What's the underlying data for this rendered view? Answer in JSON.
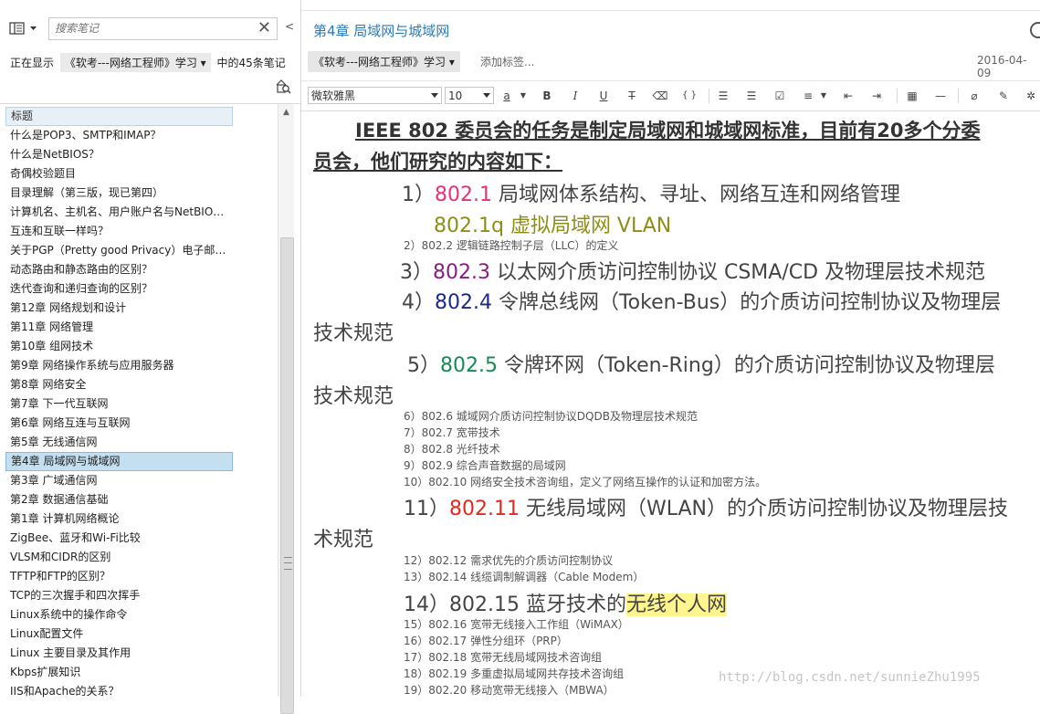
{
  "left": {
    "search_placeholder": "搜索笔记",
    "showing_prefix": "正在显示",
    "notebook_name": "《软考---网络工程师》学习",
    "showing_suffix": "中的45条笔记",
    "list_header": "标题",
    "notes": [
      "什么是POP3、SMTP和IMAP？",
      "什么是NetBIOS？",
      "奇偶校验题目",
      "目录理解（第三版，现已第四）",
      "计算机名、主机名、用户账户名与NetBIO…",
      "互连和互联一样吗？",
      "关于PGP（Pretty good Privacy）电子邮…",
      "动态路由和静态路由的区别？",
      "迭代查询和递归查询的区别？",
      "第12章 网络规划和设计",
      "第11章 网络管理",
      "第10章 组网技术",
      "第9章 网络操作系统与应用服务器",
      "第8章 网络安全",
      "第7章 下一代互联网",
      "第6章 网络互连与互联网",
      "第5章 无线通信网",
      "第4章 局域网与城域网",
      "第3章 广域通信网",
      "第2章 数据通信基础",
      "第1章 计算机网络概论",
      "ZigBee、蓝牙和Wi-Fi比较",
      "VLSM和CIDR的区别",
      "TFTP和FTP的区别？",
      "TCP的三次握手和四次挥手",
      "Linux系统中的操作命令",
      "Linux配置文件",
      "Linux 主要目录及其作用",
      "Kbps扩展知识",
      "IIS和Apache的关系？"
    ]
  },
  "note": {
    "title": "第4章 局域网与城域网",
    "notebook_tag": "《软考---网络工程师》学习",
    "add_tag": "添加标签...",
    "date": "2016-04-09",
    "font": "微软雅黑",
    "size": "10",
    "heading_line1": "IEEE 802 委员会的任务是制定局域网和城域网标准，目前有20多个分委",
    "heading_line2": "员会，他们研究的内容如下：",
    "l1a": "1）",
    "l1b": "802.1",
    "l1c": " 局域网体系结构、寻址、网络互连和网络管理",
    "l1q": "802.1q 虚拟局域网 VLAN",
    "l2": "2）802.2 逻辑链路控制子层（LLC）的定义",
    "l3a": "3）",
    "l3b": "802.3",
    "l3c": " 以太网介质访问控制协议 CSMA/CD 及物理层技术规范",
    "l4a": "4）",
    "l4b": "802.4",
    "l4c": " 令牌总线网（Token-Bus）的介质访问控制协议及物理层",
    "l4d": "技术规范",
    "l5a": "5）",
    "l5b": "802.5",
    "l5c": " 令牌环网（Token-Ring）的介质访问控制协议及物理层",
    "l5d": "技术规范",
    "l6": "6）802.6 城域网介质访问控制协议DQDB及物理层技术规范",
    "l7": "7）802.7 宽带技术",
    "l8": "8）802.8 光纤技术",
    "l9": "9）802.9 综合声音数据的局域网",
    "l10": "10）802.10 网络安全技术咨询组，定义了网络互操作的认证和加密方法。",
    "l11a": "11）",
    "l11b": "802.11",
    "l11c": " 无线局域网（WLAN）的介质访问控制协议及物理层技",
    "l11d": "术规范",
    "l12": "12）802.12 需求优先的介质访问控制协议",
    "l13": "13）802.14 线缆调制解调器（Cable Modem）",
    "l14a": "14）802.15 蓝牙技术的",
    "l14b": "无线个人网",
    "l15": "15）802.16 宽带无线接入工作组（WiMAX）",
    "l16": "16）802.17 弹性分组环（PRP）",
    "l17": "17）802.18 宽带无线局域网技术咨询组",
    "l18": "18）802.19 多重虚拟局域网共存技术咨询组",
    "l19": "19）802.20 移动宽带无线接入（MBWA）"
  },
  "watermark": "http://blog.csdn.net/sunnieZhu1995",
  "colors": {
    "c8021": "#e5307a",
    "c8021q": "#8d8d18",
    "c8023": "#8b1c86",
    "c8024": "#1b2a87",
    "c8025": "#168a57",
    "c80211": "#e3291b",
    "highlight": "#fff58f",
    "selected_row": "#c4dff0",
    "title_blue": "#2a7ab8"
  },
  "icons": [
    "view-toggle-icon",
    "close-icon",
    "search-notes-icon",
    "bold-icon",
    "italic-icon",
    "underline-icon",
    "strikethrough-icon",
    "eraser-icon",
    "code-icon",
    "bullet-list-icon",
    "numbered-list-icon",
    "checkbox-icon",
    "align-icon",
    "outdent-icon",
    "indent-icon",
    "table-icon",
    "horizontal-rule-icon",
    "attachment-icon",
    "highlighter-icon",
    "more-icon"
  ]
}
